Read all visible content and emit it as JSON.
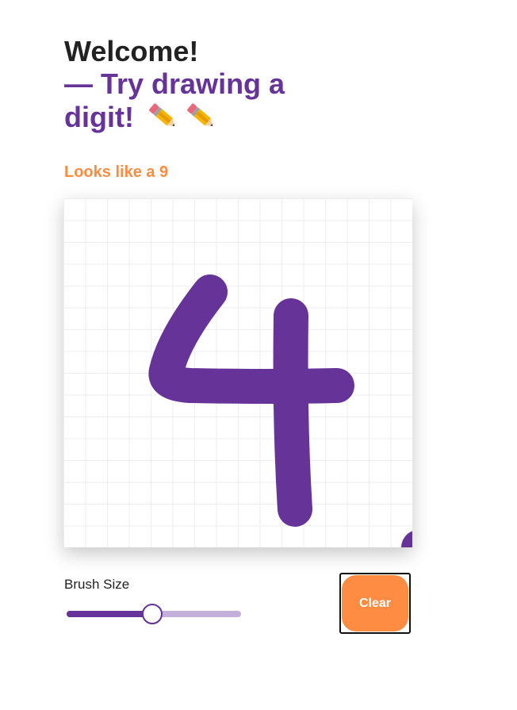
{
  "header": {
    "welcome": "Welcome!",
    "subtitle": "— Try drawing a digit!",
    "icons": [
      "pencil-icon",
      "pencil-icon"
    ]
  },
  "prediction": {
    "text": "Looks like a 9"
  },
  "canvas": {
    "stroke_color": "#663399",
    "grid_color": "#eeeeee"
  },
  "controls": {
    "brush_label": "Brush Size",
    "brush_value": 0.49,
    "clear_label": "Clear"
  },
  "colors": {
    "accent": "#663399",
    "orange": "#ff8c42",
    "text": "#222222",
    "slider_track": "#c3afd9"
  }
}
